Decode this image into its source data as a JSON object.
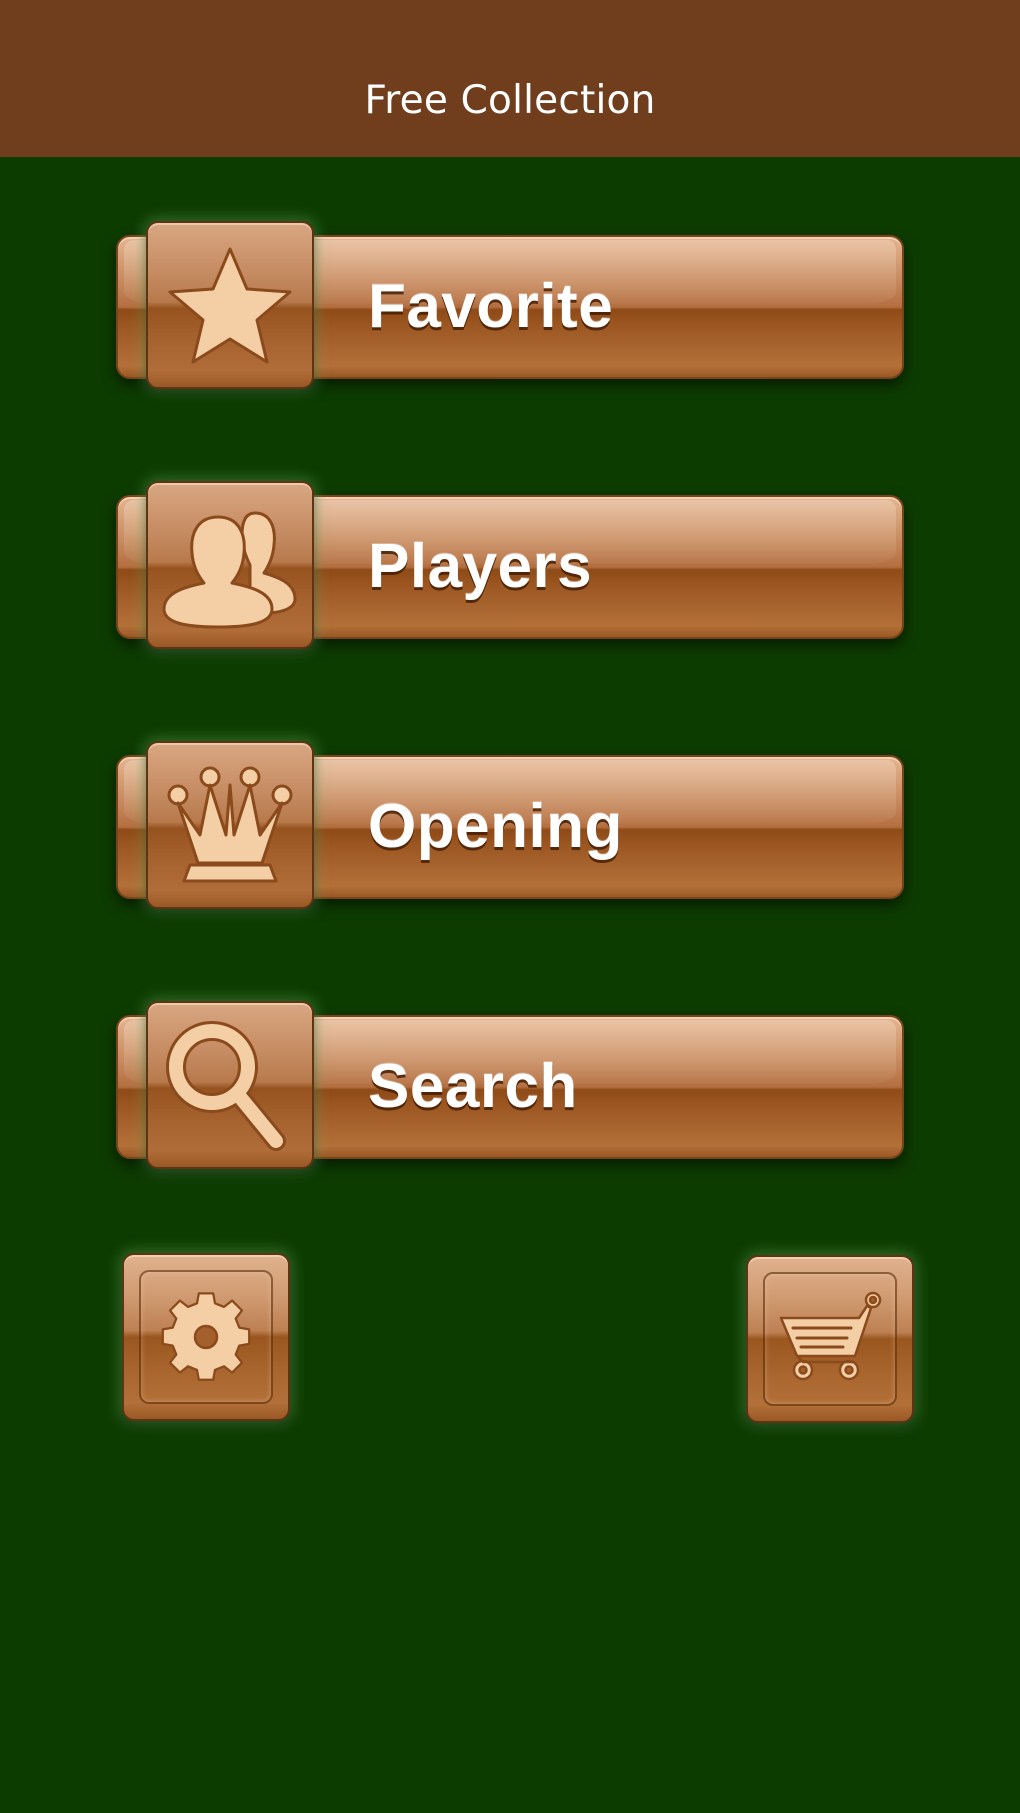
{
  "nav": {
    "title": "Free Collection"
  },
  "menu": {
    "items": [
      {
        "label": "Favorite",
        "icon": "star-icon"
      },
      {
        "label": "Players",
        "icon": "players-icon"
      },
      {
        "label": "Opening",
        "icon": "crown-icon"
      },
      {
        "label": "Search",
        "icon": "magnifier-icon"
      }
    ]
  },
  "bottom": {
    "settings_icon": "gear-icon",
    "store_icon": "cart-icon"
  },
  "colors": {
    "navbar": "#713e1d",
    "background": "#0d3c00",
    "wood_light": "#e4b592",
    "wood_dark": "#8e4a17",
    "icon_fill": "#f4cfa6"
  }
}
